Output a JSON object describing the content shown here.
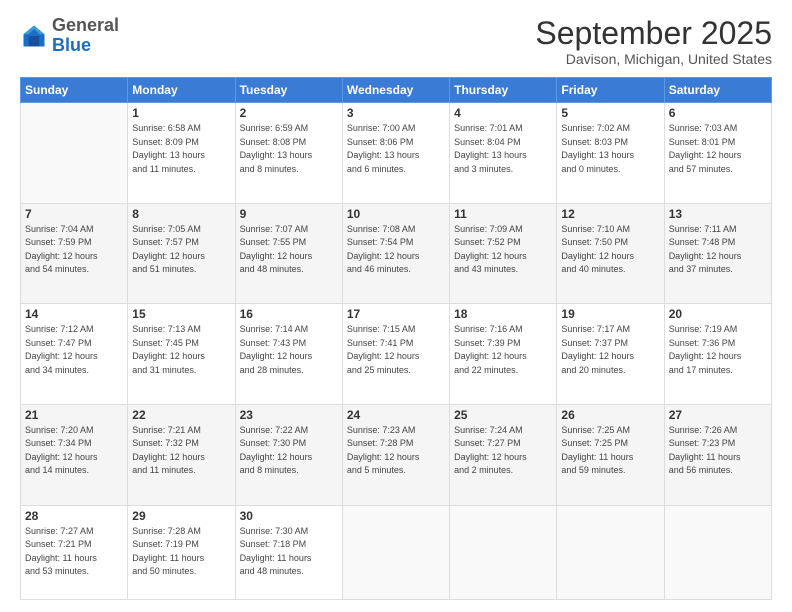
{
  "logo": {
    "general": "General",
    "blue": "Blue"
  },
  "header": {
    "month_year": "September 2025",
    "location": "Davison, Michigan, United States"
  },
  "days_of_week": [
    "Sunday",
    "Monday",
    "Tuesday",
    "Wednesday",
    "Thursday",
    "Friday",
    "Saturday"
  ],
  "weeks": [
    [
      {
        "day": "",
        "info": ""
      },
      {
        "day": "1",
        "info": "Sunrise: 6:58 AM\nSunset: 8:09 PM\nDaylight: 13 hours\nand 11 minutes."
      },
      {
        "day": "2",
        "info": "Sunrise: 6:59 AM\nSunset: 8:08 PM\nDaylight: 13 hours\nand 8 minutes."
      },
      {
        "day": "3",
        "info": "Sunrise: 7:00 AM\nSunset: 8:06 PM\nDaylight: 13 hours\nand 6 minutes."
      },
      {
        "day": "4",
        "info": "Sunrise: 7:01 AM\nSunset: 8:04 PM\nDaylight: 13 hours\nand 3 minutes."
      },
      {
        "day": "5",
        "info": "Sunrise: 7:02 AM\nSunset: 8:03 PM\nDaylight: 13 hours\nand 0 minutes."
      },
      {
        "day": "6",
        "info": "Sunrise: 7:03 AM\nSunset: 8:01 PM\nDaylight: 12 hours\nand 57 minutes."
      }
    ],
    [
      {
        "day": "7",
        "info": "Sunrise: 7:04 AM\nSunset: 7:59 PM\nDaylight: 12 hours\nand 54 minutes."
      },
      {
        "day": "8",
        "info": "Sunrise: 7:05 AM\nSunset: 7:57 PM\nDaylight: 12 hours\nand 51 minutes."
      },
      {
        "day": "9",
        "info": "Sunrise: 7:07 AM\nSunset: 7:55 PM\nDaylight: 12 hours\nand 48 minutes."
      },
      {
        "day": "10",
        "info": "Sunrise: 7:08 AM\nSunset: 7:54 PM\nDaylight: 12 hours\nand 46 minutes."
      },
      {
        "day": "11",
        "info": "Sunrise: 7:09 AM\nSunset: 7:52 PM\nDaylight: 12 hours\nand 43 minutes."
      },
      {
        "day": "12",
        "info": "Sunrise: 7:10 AM\nSunset: 7:50 PM\nDaylight: 12 hours\nand 40 minutes."
      },
      {
        "day": "13",
        "info": "Sunrise: 7:11 AM\nSunset: 7:48 PM\nDaylight: 12 hours\nand 37 minutes."
      }
    ],
    [
      {
        "day": "14",
        "info": "Sunrise: 7:12 AM\nSunset: 7:47 PM\nDaylight: 12 hours\nand 34 minutes."
      },
      {
        "day": "15",
        "info": "Sunrise: 7:13 AM\nSunset: 7:45 PM\nDaylight: 12 hours\nand 31 minutes."
      },
      {
        "day": "16",
        "info": "Sunrise: 7:14 AM\nSunset: 7:43 PM\nDaylight: 12 hours\nand 28 minutes."
      },
      {
        "day": "17",
        "info": "Sunrise: 7:15 AM\nSunset: 7:41 PM\nDaylight: 12 hours\nand 25 minutes."
      },
      {
        "day": "18",
        "info": "Sunrise: 7:16 AM\nSunset: 7:39 PM\nDaylight: 12 hours\nand 22 minutes."
      },
      {
        "day": "19",
        "info": "Sunrise: 7:17 AM\nSunset: 7:37 PM\nDaylight: 12 hours\nand 20 minutes."
      },
      {
        "day": "20",
        "info": "Sunrise: 7:19 AM\nSunset: 7:36 PM\nDaylight: 12 hours\nand 17 minutes."
      }
    ],
    [
      {
        "day": "21",
        "info": "Sunrise: 7:20 AM\nSunset: 7:34 PM\nDaylight: 12 hours\nand 14 minutes."
      },
      {
        "day": "22",
        "info": "Sunrise: 7:21 AM\nSunset: 7:32 PM\nDaylight: 12 hours\nand 11 minutes."
      },
      {
        "day": "23",
        "info": "Sunrise: 7:22 AM\nSunset: 7:30 PM\nDaylight: 12 hours\nand 8 minutes."
      },
      {
        "day": "24",
        "info": "Sunrise: 7:23 AM\nSunset: 7:28 PM\nDaylight: 12 hours\nand 5 minutes."
      },
      {
        "day": "25",
        "info": "Sunrise: 7:24 AM\nSunset: 7:27 PM\nDaylight: 12 hours\nand 2 minutes."
      },
      {
        "day": "26",
        "info": "Sunrise: 7:25 AM\nSunset: 7:25 PM\nDaylight: 11 hours\nand 59 minutes."
      },
      {
        "day": "27",
        "info": "Sunrise: 7:26 AM\nSunset: 7:23 PM\nDaylight: 11 hours\nand 56 minutes."
      }
    ],
    [
      {
        "day": "28",
        "info": "Sunrise: 7:27 AM\nSunset: 7:21 PM\nDaylight: 11 hours\nand 53 minutes."
      },
      {
        "day": "29",
        "info": "Sunrise: 7:28 AM\nSunset: 7:19 PM\nDaylight: 11 hours\nand 50 minutes."
      },
      {
        "day": "30",
        "info": "Sunrise: 7:30 AM\nSunset: 7:18 PM\nDaylight: 11 hours\nand 48 minutes."
      },
      {
        "day": "",
        "info": ""
      },
      {
        "day": "",
        "info": ""
      },
      {
        "day": "",
        "info": ""
      },
      {
        "day": "",
        "info": ""
      }
    ]
  ]
}
